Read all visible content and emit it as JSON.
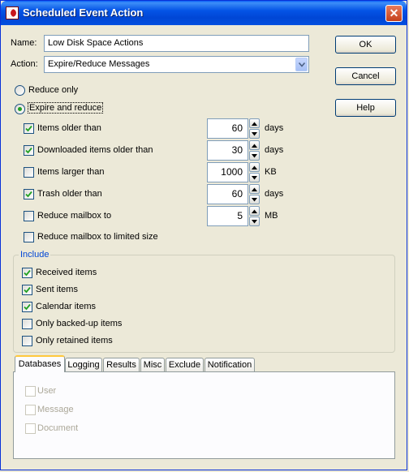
{
  "window": {
    "title": "Scheduled Event Action",
    "close": "✕"
  },
  "form": {
    "name_label": "Name:",
    "name_value": "Low Disk Space Actions",
    "action_label": "Action:",
    "action_value": "Expire/Reduce Messages"
  },
  "buttons": {
    "ok": "OK",
    "cancel": "Cancel",
    "help": "Help"
  },
  "mode": {
    "reduce_only": {
      "label": "Reduce only",
      "selected": false
    },
    "expire_reduce": {
      "label": "Expire and reduce",
      "selected": true
    }
  },
  "criteria": [
    {
      "label": "Items older than",
      "checked": true,
      "value": "60",
      "unit": "days"
    },
    {
      "label": "Downloaded items older than",
      "checked": true,
      "value": "30",
      "unit": "days"
    },
    {
      "label": "Items larger than",
      "checked": false,
      "value": "1000",
      "unit": "KB"
    },
    {
      "label": "Trash older than",
      "checked": true,
      "value": "60",
      "unit": "days"
    },
    {
      "label": "Reduce mailbox to",
      "checked": false,
      "value": "5",
      "unit": "MB"
    }
  ],
  "reduce_limited": {
    "label": "Reduce mailbox to limited size",
    "checked": false
  },
  "include": {
    "title": "Include",
    "items": [
      {
        "label": "Received items",
        "checked": true
      },
      {
        "label": "Sent items",
        "checked": true
      },
      {
        "label": "Calendar items",
        "checked": true
      },
      {
        "label": "Only backed-up items",
        "checked": false
      },
      {
        "label": "Only retained items",
        "checked": false
      }
    ]
  },
  "tabs": [
    "Databases",
    "Logging",
    "Results",
    "Misc",
    "Exclude",
    "Notification"
  ],
  "databases": [
    {
      "label": "User",
      "checked": true
    },
    {
      "label": "Message",
      "checked": false
    },
    {
      "label": "Document",
      "checked": false
    }
  ]
}
